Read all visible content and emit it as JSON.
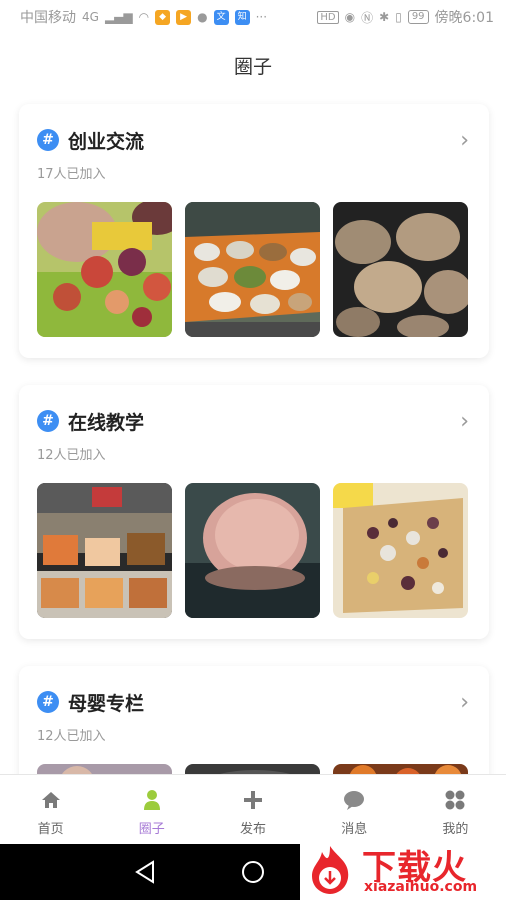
{
  "status_bar": {
    "carrier": "中国移动",
    "network": "4G",
    "battery": "99",
    "time": "傍晚6:01",
    "hd": "HD"
  },
  "header": {
    "title": "圈子"
  },
  "circles": [
    {
      "title": "创业交流",
      "members": "17人已加入",
      "images": [
        "salad-dish-photo",
        "banquet-table-photo",
        "meatballs-photo"
      ]
    },
    {
      "title": "在线教学",
      "members": "12人已加入",
      "images": [
        "deli-display-photo",
        "ham-slice-photo",
        "granola-toast-photo"
      ]
    },
    {
      "title": "母婴专栏",
      "members": "12人已加入",
      "images": [
        "kids-photo",
        "bowl-photo",
        "fruit-photo"
      ]
    }
  ],
  "bottom_nav": [
    {
      "label": "首页",
      "icon": "home-icon",
      "active": false
    },
    {
      "label": "圈子",
      "icon": "person-icon",
      "active": true
    },
    {
      "label": "发布",
      "icon": "plus-icon",
      "active": false
    },
    {
      "label": "消息",
      "icon": "chat-icon",
      "active": false
    },
    {
      "label": "我的",
      "icon": "grid-icon",
      "active": false
    }
  ],
  "watermark": {
    "brand": "下载火",
    "url": "xiazaihuo.com"
  },
  "colors": {
    "accent": "#a77bd6",
    "hash_badge": "#3d8ef3",
    "watermark": "#e8262c"
  }
}
